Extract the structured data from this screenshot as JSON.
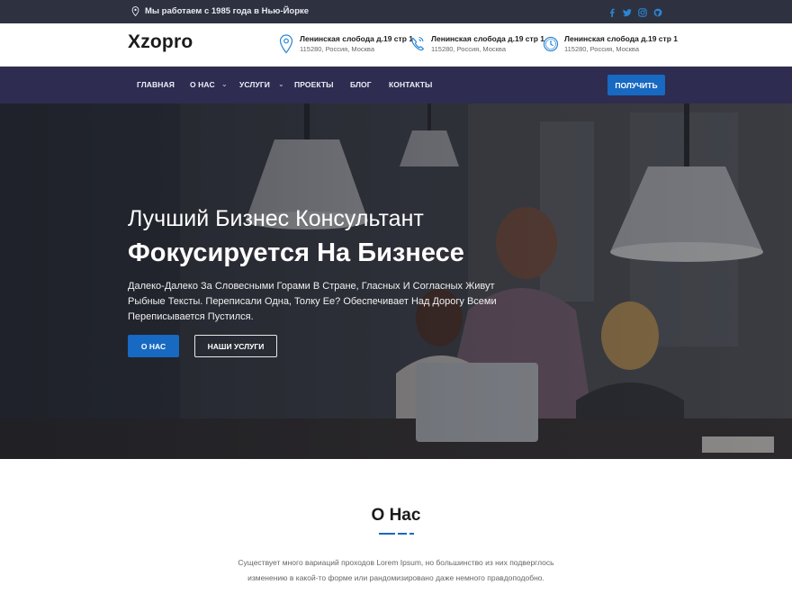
{
  "topbar": {
    "location_text": "Мы работаем с 1985 года в Нью-Йорке",
    "socials": [
      "facebook-icon",
      "twitter-icon",
      "instagram-icon",
      "github-icon"
    ]
  },
  "header": {
    "logo": "Xzopro",
    "contacts": [
      {
        "icon": "location-pin-icon",
        "line1": "Ленинская слобода д.19 стр 1",
        "line2": "115280, Россия, Москва"
      },
      {
        "icon": "phone-icon",
        "line1": "Ленинская слобода д.19 стр 1",
        "line2": "115280, Россия, Москва"
      },
      {
        "icon": "clock-icon",
        "line1": "Ленинская слобода д.19 стр 1",
        "line2": "115280, Россия, Москва"
      }
    ]
  },
  "nav": {
    "items": [
      "ГЛАВНАЯ",
      "О НАС",
      "УСЛУГИ",
      "ПРОЕКТЫ",
      "БЛОГ",
      "КОНТАКТЫ"
    ],
    "cta": "ПОЛУЧИТЬ"
  },
  "hero": {
    "subtitle": "Лучший Бизнес Консультант",
    "title": "Фокусируется На Бизнесе",
    "description": "Далеко-Далеко За Словесными Горами В Стране, Гласных И Согласных Живут Рыбные Тексты. Переписали Одна, Толку Ее? Обеспечивает Над Дорогу Всеми Переписывается Пустился.",
    "btn_primary": "О НАС",
    "btn_secondary": "НАШИ УСЛУГИ"
  },
  "about": {
    "title": "О Нас",
    "text": "Существует много вариаций проходов Lorem Ipsum, но большинство из них подверглось изменению в какой-то форме или рандомизировано даже немного правдоподобно."
  },
  "colors": {
    "accent": "#1769c2",
    "topbar_bg": "#2e3240",
    "nav_bg": "#2e2c51"
  }
}
